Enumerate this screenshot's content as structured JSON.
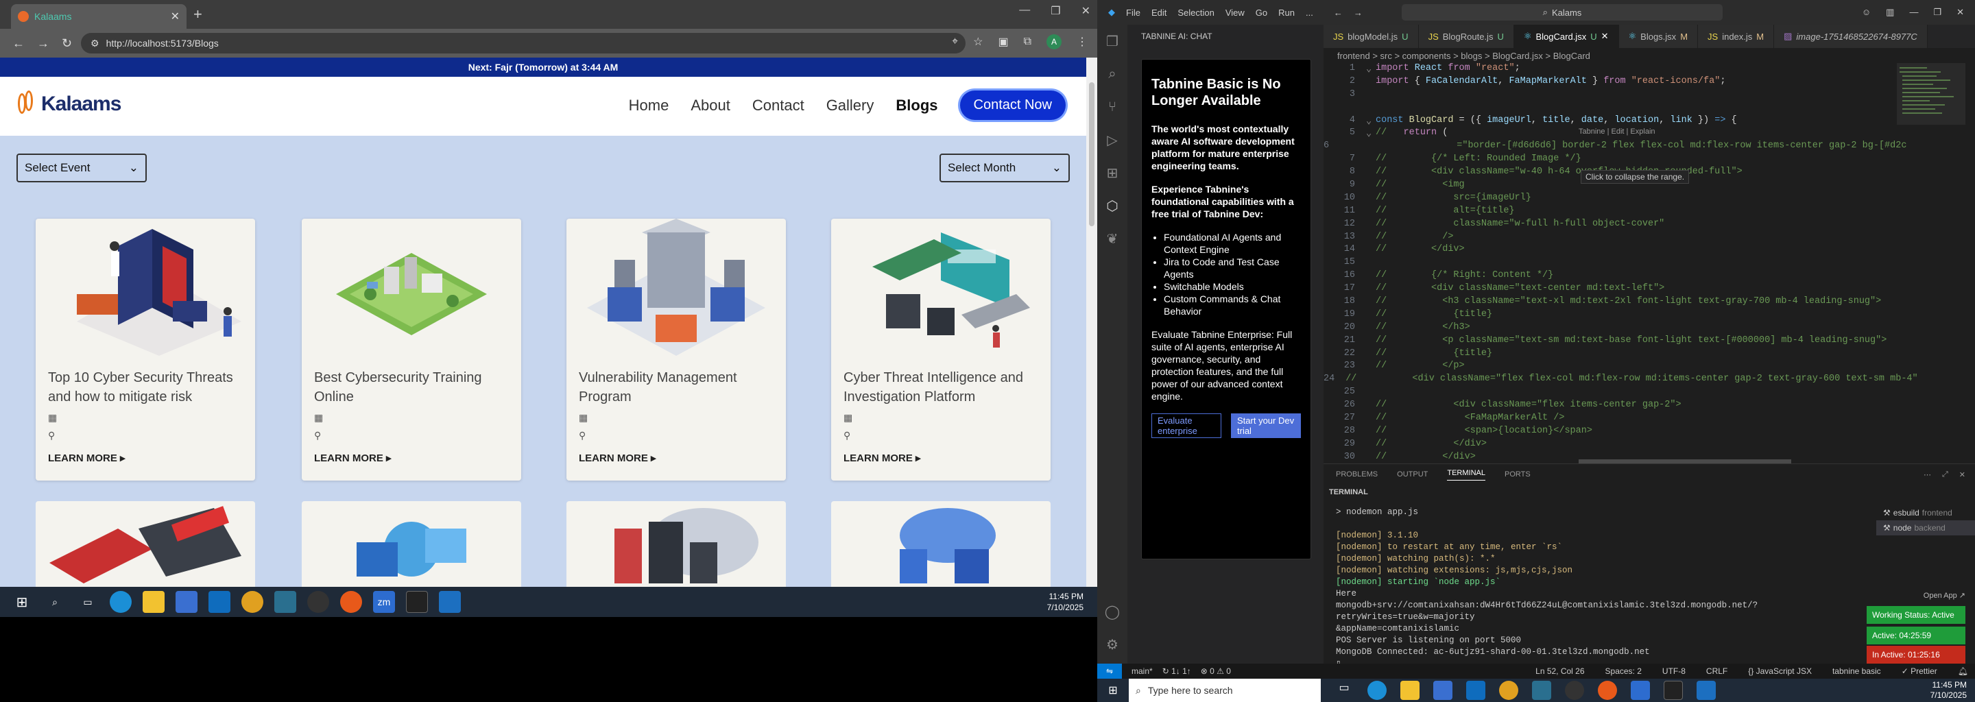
{
  "browser": {
    "tab_title": "Kalaams",
    "url": "http://localhost:5173/Blogs",
    "avatar_letter": "A"
  },
  "site": {
    "prayer_bar": "Next: Fajr (Tomorrow) at 3:44 AM",
    "logo": "Kalaams",
    "nav": [
      "Home",
      "About",
      "Contact",
      "Gallery",
      "Blogs"
    ],
    "contact_button": "Contact Now",
    "select_event": "Select Event",
    "select_month": "Select Month",
    "learn_more": "LEARN MORE ▸",
    "cards": [
      {
        "title": "Top 10 Cyber Security Threats and how to mitigate risk"
      },
      {
        "title": "Best Cybersecurity Training Online"
      },
      {
        "title": "Vulnerability Management Program"
      },
      {
        "title": "Cyber Threat Intelligence and Investigation Platform"
      }
    ]
  },
  "taskbar_left": {
    "time": "11:45 PM",
    "date": "7/10/2025"
  },
  "vscode": {
    "menu": [
      "File",
      "Edit",
      "Selection",
      "View",
      "Go",
      "Run",
      "..."
    ],
    "search": "Kalams",
    "tabnine_header": "TABNINE AI: CHAT",
    "tabnine": {
      "heading": "Tabnine Basic is No Longer Available",
      "p1": "The world's most contextually aware AI software development platform for mature enterprise engineering teams.",
      "p2": "Experience Tabnine's foundational capabilities with a free trial of Tabnine Dev:",
      "list": [
        "Foundational AI Agents and Context Engine",
        "Jira to Code and Test Case Agents",
        "Switchable Models",
        "Custom Commands & Chat Behavior"
      ],
      "p3": "Evaluate Tabnine Enterprise: Full suite of AI agents, enterprise AI governance, security, and protection features, and the full power of our advanced context engine.",
      "btn1": "Evaluate enterprise",
      "btn2": "Start your Dev trial"
    },
    "tabs": [
      {
        "name": "blogModel.js",
        "flag": "U"
      },
      {
        "name": "BlogRoute.js",
        "flag": "U"
      },
      {
        "name": "BlogCard.jsx",
        "flag": "U"
      },
      {
        "name": "Blogs.jsx",
        "flag": "M"
      },
      {
        "name": "index.js",
        "flag": "M"
      },
      {
        "name": "image-1751468522674-8977C",
        "flag": ""
      }
    ],
    "breadcrumb": "frontend > src > components > blogs > BlogCard.jsx > BlogCard",
    "codelens": "Tabnine | Edit | Explain",
    "tooltip": "Click to collapse the range.",
    "panel_tabs": [
      "PROBLEMS",
      "OUTPUT",
      "TERMINAL",
      "PORTS"
    ],
    "terminal_label": "TERMINAL",
    "terminal_lines": [
      "> nodemon app.js",
      "",
      "[nodemon] 3.1.10",
      "[nodemon] to restart at any time, enter `rs`",
      "[nodemon] watching path(s): *.*",
      "[nodemon] watching extensions: js,mjs,cjs,json",
      "[nodemon] starting `node app.js`",
      "Here",
      "mongodb+srv://comtanixahsan:dW4Hr6tTd66Z24uL@comtanixislamic.3tel3zd.mongodb.net/?retryWrites=true&w=majority",
      "&appName=comtanixislamic",
      "POS Server is listening on port 5000",
      "MongoDB Connected: ac-6utjz91-shard-00-01.3tel3zd.mongodb.net"
    ],
    "processes": [
      {
        "name": "esbuild",
        "sub": "frontend"
      },
      {
        "name": "node",
        "sub": "backend"
      }
    ],
    "open_app": "Open App ↗",
    "working_status": "Working Status: Active",
    "active": "Active: 04:25:59",
    "inactive": "In Active: 01:25:16",
    "status": {
      "branch": "main*",
      "sync": "↻ 1↓ 1↑",
      "problems": "⊗ 0 ⚠ 0",
      "position": "Ln 52, Col 26",
      "spaces": "Spaces: 2",
      "encoding": "UTF-8",
      "eol": "CRLF",
      "lang": "{} JavaScript JSX",
      "tabnine": "tabnine basic",
      "prettier": "✓ Prettier"
    }
  },
  "taskbar_right": {
    "search_placeholder": "Type here to search",
    "time": "11:45 PM",
    "date": "7/10/2025"
  },
  "colors": {
    "site_bg": "#c7d6ee",
    "prayer_bar": "#0e2a8c",
    "contact_btn": "#0d2fcf",
    "working": "#1f9c3a",
    "inactive": "#c42b1c",
    "vs_blue": "#0078d4"
  }
}
